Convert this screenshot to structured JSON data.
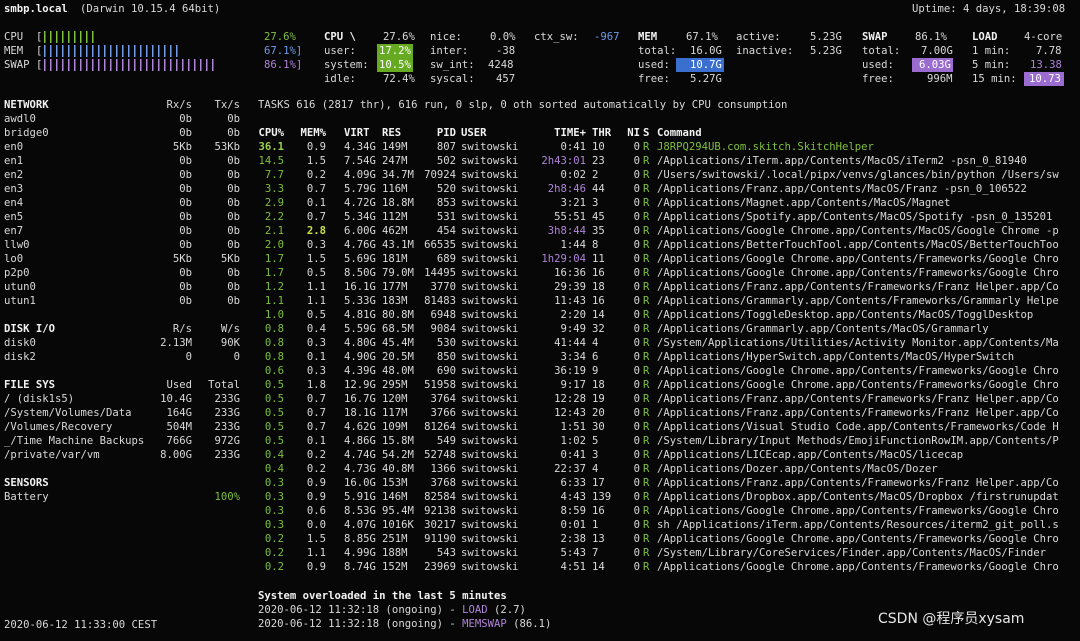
{
  "header": {
    "host": "smbp.local",
    "os": "(Darwin 10.15.4 64bit)",
    "uptime": "Uptime: 4 days, 18:39:08"
  },
  "quicklook": {
    "cpu_label": "CPU",
    "mem_label": "MEM",
    "swap_label": "SWAP",
    "cpu_pct": "27.6%",
    "mem_pct": "67.1%]",
    "swap_pct": "86.1%]",
    "cpu_fill": 0.276,
    "mem_fill": 0.671,
    "swap_fill": 0.861
  },
  "cpu": {
    "title": "CPU \\",
    "total": "27.6%",
    "user_label": "user:",
    "user": "17.2%",
    "system_label": "system:",
    "system": "10.5%",
    "idle_label": "idle:",
    "idle": "72.4%",
    "nice_label": "nice:",
    "nice": "0.0%",
    "inter_label": "inter:",
    "inter": "-38",
    "swint_label": "sw_int:",
    "swint": "4248",
    "syscal_label": "syscal:",
    "syscal": "457",
    "ctxsw_label": "ctx_sw:",
    "ctxsw": "-967"
  },
  "mem": {
    "title": "MEM",
    "pct": "67.1%",
    "total_label": "total:",
    "total": "16.0G",
    "used_label": "used:",
    "used": "10.7G",
    "free_label": "free:",
    "free": "5.27G",
    "active_label": "active:",
    "active": "5.23G",
    "inactive_label": "inactive:",
    "inactive": "5.23G"
  },
  "swap": {
    "title": "SWAP",
    "pct": "86.1%",
    "total_label": "total:",
    "total": "7.00G",
    "used_label": "used:",
    "used": "6.03G",
    "free_label": "free:",
    "free": "996M"
  },
  "load": {
    "title": "LOAD",
    "cores": "4-core",
    "m1_label": "1 min:",
    "m1": "7.78",
    "m5_label": "5 min:",
    "m5": "13.38",
    "m15_label": "15 min:",
    "m15": "10.73"
  },
  "network": {
    "title": "NETWORK",
    "rx_h": "Rx/s",
    "tx_h": "Tx/s",
    "rows": [
      [
        "awdl0",
        "0b",
        "0b"
      ],
      [
        "bridge0",
        "0b",
        "0b"
      ],
      [
        "en0",
        "5Kb",
        "53Kb"
      ],
      [
        "en1",
        "0b",
        "0b"
      ],
      [
        "en2",
        "0b",
        "0b"
      ],
      [
        "en3",
        "0b",
        "0b"
      ],
      [
        "en4",
        "0b",
        "0b"
      ],
      [
        "en5",
        "0b",
        "0b"
      ],
      [
        "en7",
        "0b",
        "0b"
      ],
      [
        "llw0",
        "0b",
        "0b"
      ],
      [
        "lo0",
        "5Kb",
        "5Kb"
      ],
      [
        "p2p0",
        "0b",
        "0b"
      ],
      [
        "utun0",
        "0b",
        "0b"
      ],
      [
        "utun1",
        "0b",
        "0b"
      ]
    ]
  },
  "diskio": {
    "title": "DISK I/O",
    "r_h": "R/s",
    "w_h": "W/s",
    "rows": [
      [
        "disk0",
        "2.13M",
        "90K"
      ],
      [
        "disk2",
        "0",
        "0"
      ]
    ]
  },
  "filesys": {
    "title": "FILE SYS",
    "used_h": "Used",
    "total_h": "Total",
    "rows": [
      [
        "/ (disk1s5)",
        "10.4G",
        "233G"
      ],
      [
        "/System/Volumes/Data",
        "164G",
        "233G"
      ],
      [
        "/Volumes/Recovery",
        "504M",
        "233G"
      ],
      [
        "_/Time Machine Backups",
        "766G",
        "972G"
      ],
      [
        "/private/var/vm",
        "8.00G",
        "233G"
      ]
    ]
  },
  "sensors": {
    "title": "SENSORS",
    "battery_label": "Battery",
    "battery": "100%"
  },
  "tasks": {
    "summary": "TASKS 616 (2817 thr), 616 run, 0 slp, 0 oth sorted automatically by CPU consumption",
    "headers": [
      "CPU%",
      "MEM%",
      "VIRT",
      "RES",
      "PID",
      "USER",
      "TIME+",
      "THR",
      "NI",
      "S",
      "Command"
    ],
    "rows": [
      [
        "36.1",
        "0.9",
        "4.34G",
        "149M",
        "807",
        "switowski",
        "0:41",
        "10",
        "0",
        "R",
        "J8RPQ294UB.com.skitch.SkitchHelper"
      ],
      [
        "14.5",
        "1.5",
        "7.54G",
        "247M",
        "502",
        "switowski",
        "2h43:01",
        "23",
        "0",
        "R",
        "/Applications/iTerm.app/Contents/MacOS/iTerm2 -psn_0_81940"
      ],
      [
        "7.7",
        "0.2",
        "4.09G",
        "34.7M",
        "70924",
        "switowski",
        "0:02",
        "2",
        "0",
        "R",
        "/Users/switowski/.local/pipx/venvs/glances/bin/python /Users/sw"
      ],
      [
        "3.3",
        "0.7",
        "5.79G",
        "116M",
        "520",
        "switowski",
        "2h8:46",
        "44",
        "0",
        "R",
        "/Applications/Franz.app/Contents/MacOS/Franz -psn_0_106522"
      ],
      [
        "2.9",
        "0.1",
        "4.72G",
        "18.8M",
        "853",
        "switowski",
        "3:21",
        "3",
        "0",
        "R",
        "/Applications/Magnet.app/Contents/MacOS/Magnet"
      ],
      [
        "2.2",
        "0.7",
        "5.34G",
        "112M",
        "531",
        "switowski",
        "55:51",
        "45",
        "0",
        "R",
        "/Applications/Spotify.app/Contents/MacOS/Spotify -psn_0_135201"
      ],
      [
        "2.1",
        "2.8",
        "6.00G",
        "462M",
        "454",
        "switowski",
        "3h8:44",
        "35",
        "0",
        "R",
        "/Applications/Google Chrome.app/Contents/MacOS/Google Chrome -p"
      ],
      [
        "2.0",
        "0.3",
        "4.76G",
        "43.1M",
        "66535",
        "switowski",
        "1:44",
        "8",
        "0",
        "R",
        "/Applications/BetterTouchTool.app/Contents/MacOS/BetterTouchToo"
      ],
      [
        "1.7",
        "1.5",
        "5.69G",
        "181M",
        "689",
        "switowski",
        "1h29:04",
        "11",
        "0",
        "R",
        "/Applications/Google Chrome.app/Contents/Frameworks/Google Chro"
      ],
      [
        "1.7",
        "0.5",
        "8.50G",
        "79.0M",
        "14495",
        "switowski",
        "16:36",
        "16",
        "0",
        "R",
        "/Applications/Google Chrome.app/Contents/Frameworks/Google Chro"
      ],
      [
        "1.2",
        "1.1",
        "16.1G",
        "177M",
        "3770",
        "switowski",
        "29:39",
        "18",
        "0",
        "R",
        "/Applications/Franz.app/Contents/Frameworks/Franz Helper.app/Co"
      ],
      [
        "1.1",
        "1.1",
        "5.33G",
        "183M",
        "81483",
        "switowski",
        "11:43",
        "16",
        "0",
        "R",
        "/Applications/Grammarly.app/Contents/Frameworks/Grammarly Helpe"
      ],
      [
        "1.0",
        "0.5",
        "4.81G",
        "80.8M",
        "6948",
        "switowski",
        "2:20",
        "14",
        "0",
        "R",
        "/Applications/ToggleDesktop.app/Contents/MacOS/TogglDesktop"
      ],
      [
        "0.8",
        "0.4",
        "5.59G",
        "68.5M",
        "9084",
        "switowski",
        "9:49",
        "32",
        "0",
        "R",
        "/Applications/Grammarly.app/Contents/MacOS/Grammarly"
      ],
      [
        "0.8",
        "0.3",
        "4.80G",
        "45.4M",
        "530",
        "switowski",
        "41:44",
        "4",
        "0",
        "R",
        "/System/Applications/Utilities/Activity Monitor.app/Contents/Ma"
      ],
      [
        "0.8",
        "0.1",
        "4.90G",
        "20.5M",
        "850",
        "switowski",
        "3:34",
        "6",
        "0",
        "R",
        "/Applications/HyperSwitch.app/Contents/MacOS/HyperSwitch"
      ],
      [
        "0.6",
        "0.3",
        "4.39G",
        "48.0M",
        "690",
        "switowski",
        "36:19",
        "9",
        "0",
        "R",
        "/Applications/Google Chrome.app/Contents/Frameworks/Google Chro"
      ],
      [
        "0.5",
        "1.8",
        "12.9G",
        "295M",
        "51958",
        "switowski",
        "9:17",
        "18",
        "0",
        "R",
        "/Applications/Google Chrome.app/Contents/Frameworks/Google Chro"
      ],
      [
        "0.5",
        "0.7",
        "16.7G",
        "120M",
        "3764",
        "switowski",
        "12:28",
        "19",
        "0",
        "R",
        "/Applications/Franz.app/Contents/Frameworks/Franz Helper.app/Co"
      ],
      [
        "0.5",
        "0.7",
        "18.1G",
        "117M",
        "3766",
        "switowski",
        "12:43",
        "20",
        "0",
        "R",
        "/Applications/Franz.app/Contents/Frameworks/Franz Helper.app/Co"
      ],
      [
        "0.5",
        "0.7",
        "4.62G",
        "109M",
        "81264",
        "switowski",
        "1:51",
        "30",
        "0",
        "R",
        "/Applications/Visual Studio Code.app/Contents/Frameworks/Code H"
      ],
      [
        "0.5",
        "0.1",
        "4.86G",
        "15.8M",
        "549",
        "switowski",
        "1:02",
        "5",
        "0",
        "R",
        "/System/Library/Input Methods/EmojiFunctionRowIM.app/Contents/P"
      ],
      [
        "0.4",
        "0.2",
        "4.74G",
        "54.2M",
        "52748",
        "switowski",
        "0:41",
        "3",
        "0",
        "R",
        "/Applications/LICEcap.app/Contents/MacOS/licecap"
      ],
      [
        "0.4",
        "0.2",
        "4.73G",
        "40.8M",
        "1366",
        "switowski",
        "22:37",
        "4",
        "0",
        "R",
        "/Applications/Dozer.app/Contents/MacOS/Dozer"
      ],
      [
        "0.3",
        "0.9",
        "16.0G",
        "153M",
        "3768",
        "switowski",
        "6:33",
        "17",
        "0",
        "R",
        "/Applications/Franz.app/Contents/Frameworks/Franz Helper.app/Co"
      ],
      [
        "0.3",
        "0.9",
        "5.91G",
        "146M",
        "82584",
        "switowski",
        "4:43",
        "139",
        "0",
        "R",
        "/Applications/Dropbox.app/Contents/MacOS/Dropbox /firstrunupdat"
      ],
      [
        "0.3",
        "0.6",
        "8.53G",
        "95.4M",
        "92138",
        "switowski",
        "8:59",
        "16",
        "0",
        "R",
        "/Applications/Google Chrome.app/Contents/Frameworks/Google Chro"
      ],
      [
        "0.3",
        "0.0",
        "4.07G",
        "1016K",
        "30217",
        "switowski",
        "0:01",
        "1",
        "0",
        "R",
        "sh /Applications/iTerm.app/Contents/Resources/iterm2_git_poll.s"
      ],
      [
        "0.2",
        "1.5",
        "8.85G",
        "251M",
        "91190",
        "switowski",
        "2:38",
        "13",
        "0",
        "R",
        "/Applications/Google Chrome.app/Contents/Frameworks/Google Chro"
      ],
      [
        "0.2",
        "1.1",
        "4.99G",
        "188M",
        "543",
        "switowski",
        "5:43",
        "7",
        "0",
        "R",
        "/System/Library/CoreServices/Finder.app/Contents/MacOS/Finder"
      ],
      [
        "0.2",
        "0.9",
        "8.74G",
        "152M",
        "23969",
        "switowski",
        "4:51",
        "14",
        "0",
        "R",
        "/Applications/Google Chrome.app/Contents/Frameworks/Google Chro"
      ]
    ]
  },
  "alerts": {
    "title": "System overloaded in the last 5 minutes",
    "a1_time": "2020-06-12 11:32:18 (ongoing) - ",
    "a1_name": "LOAD",
    "a1_val": " (2.7)",
    "a2_time": "2020-06-12 11:32:18 (ongoing) - ",
    "a2_name": "MEMSWAP",
    "a2_val": " (86.1)"
  },
  "footer": {
    "datetime": "2020-06-12 11:33:00 CEST",
    "watermark": "CSDN @程序员xysam"
  },
  "colors": {
    "bg": "#070707",
    "text": "#d9d9d9",
    "green": "#7fbf3f",
    "purple": "#b084d9",
    "blue": "#3a6fd0"
  }
}
